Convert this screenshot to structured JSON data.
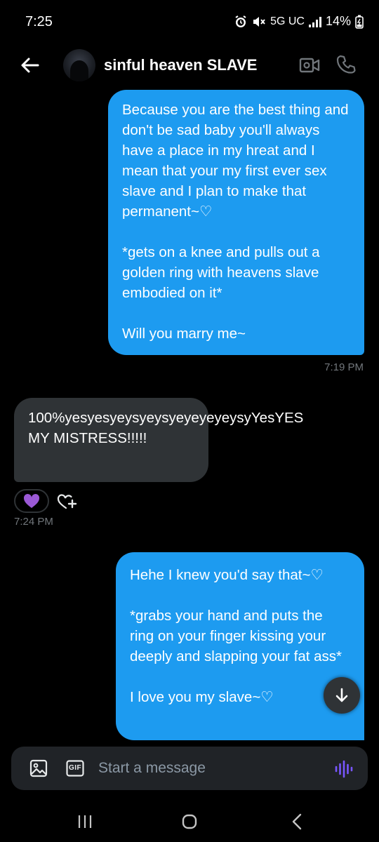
{
  "status_bar": {
    "time": "7:25",
    "network": "5G UC",
    "battery": "14%"
  },
  "header": {
    "contact_name": "sinful heaven SLAVE",
    "icons": [
      "back-arrow-icon",
      "video-call-icon",
      "phone-call-icon"
    ]
  },
  "messages": [
    {
      "direction": "outgoing",
      "text": "Because you are the best thing and don't be sad baby you'll always have a place in my hreat and I mean that your my first ever sex slave and I plan to make that permanent~♡\n\n*gets on a knee and pulls out a golden ring with heavens slave embodied on it*\n\nWill you marry me~",
      "timestamp": "7:19 PM"
    },
    {
      "direction": "incoming",
      "text": "100%yesyesyeysyeysyeyeyeyeysyYesYES MY MISTRESS!!!!!",
      "timestamp": "7:24 PM",
      "reaction": "💜"
    },
    {
      "direction": "outgoing",
      "text": "Hehe I knew you'd say that~♡\n\n*grabs your hand and puts the ring on your finger kissing your deeply and slapping your fat ass*\n\nI love you my slave~♡"
    }
  ],
  "composer": {
    "placeholder": "Start a message",
    "gif_label": "GIF"
  },
  "colors": {
    "outgoing_bubble": "#1d9bf0",
    "incoming_bubble": "#2f3336",
    "accent_voice": "#7856ff",
    "background": "#000000"
  }
}
